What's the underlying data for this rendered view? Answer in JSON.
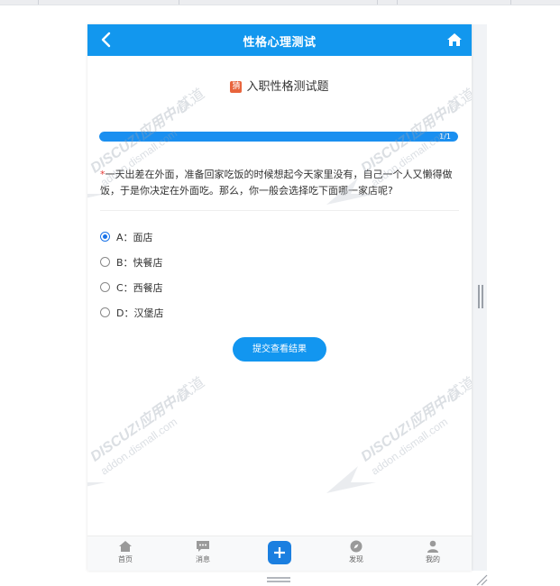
{
  "app": {
    "title": "性格心理测试"
  },
  "quiz": {
    "tag": "猜",
    "title": "入职性格测试题",
    "progress_text": "1/1",
    "progress_fraction": 1.0,
    "required_mark": "*",
    "question": "一天出差在外面，准备回家吃饭的时候想起今天家里没有，自己一个人又懒得做饭，于是你决定在外面吃。那么，你一般会选择吃下面哪一家店呢?",
    "options": [
      {
        "label": "A：面店",
        "selected": true
      },
      {
        "label": "B：快餐店",
        "selected": false
      },
      {
        "label": "C：西餐店",
        "selected": false
      },
      {
        "label": "D：汉堡店",
        "selected": false
      }
    ],
    "submit_label": "提交查看结果"
  },
  "tabbar": {
    "items": [
      {
        "label": "首页",
        "icon": "home-icon"
      },
      {
        "label": "消息",
        "icon": "message-icon"
      },
      {
        "label": "",
        "icon": "plus-icon"
      },
      {
        "label": "发现",
        "icon": "compass-icon"
      },
      {
        "label": "我的",
        "icon": "user-icon"
      }
    ]
  },
  "watermark": {
    "line1": "DISCUZ!应用中心",
    "line2": "addon.dismall.com",
    "brand": "贰道"
  },
  "colors": {
    "primary": "#1297ee",
    "tag": "#e8643c",
    "required": "#e53935"
  }
}
